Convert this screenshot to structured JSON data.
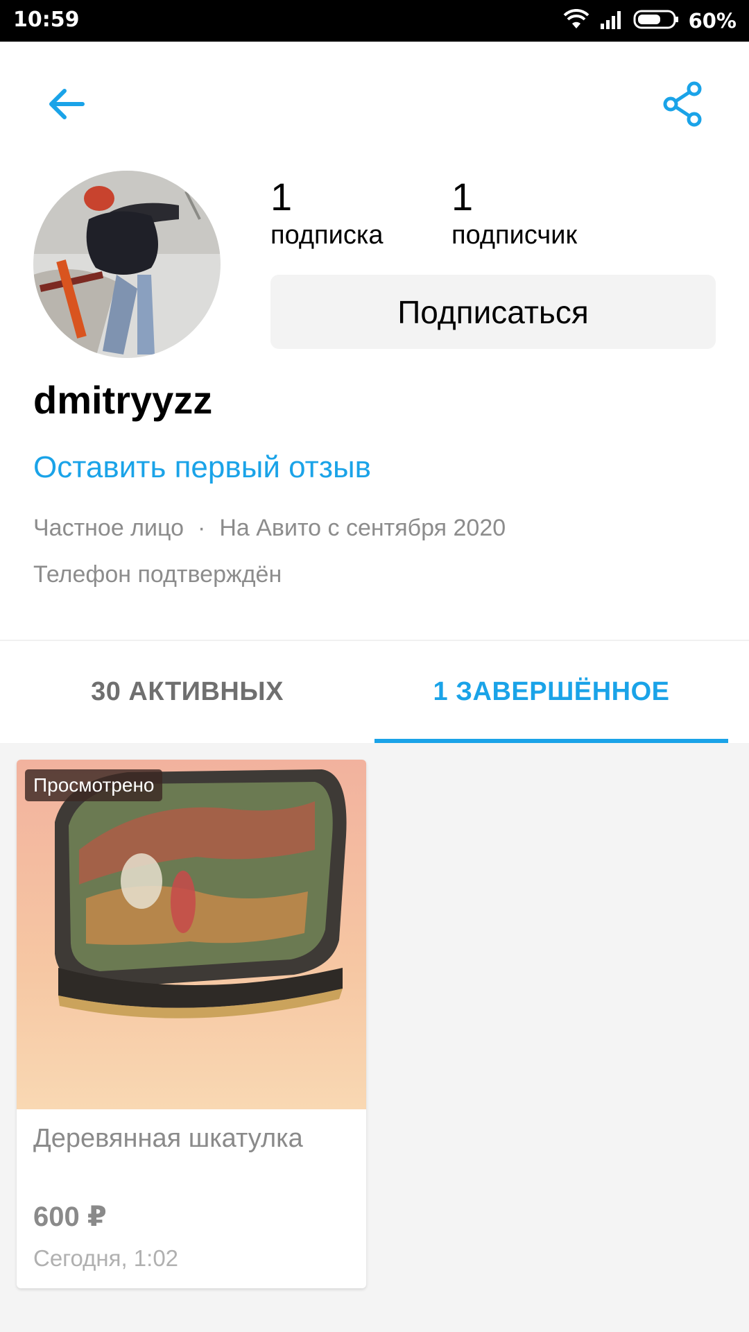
{
  "status_bar": {
    "time": "10:59",
    "battery": "60%",
    "icons": [
      "wifi-icon",
      "signal-icon",
      "battery-icon"
    ]
  },
  "toolbar": {
    "back_icon": "arrow-left-icon",
    "share_icon": "share-icon",
    "accent_color": "#1aa3e8"
  },
  "profile": {
    "subscriptions_count": "1",
    "subscriptions_label": "подписка",
    "followers_count": "1",
    "followers_label": "подписчик",
    "subscribe_button": "Подписаться",
    "username": "dmitryyzz",
    "review_link": "Оставить первый отзыв",
    "seller_type": "Частное лицо",
    "separator": "·",
    "member_since": "На Авито с сентября 2020",
    "phone_status": "Телефон подтверждён"
  },
  "tabs": [
    {
      "label": "30 АКТИВНЫХ",
      "active": false
    },
    {
      "label": "1 ЗАВЕРШЁННОЕ",
      "active": true
    }
  ],
  "listings": [
    {
      "badge": "Просмотрено",
      "title": "Деревянная шкатулка",
      "price": "600 ₽",
      "date": "Сегодня, 1:02"
    }
  ]
}
